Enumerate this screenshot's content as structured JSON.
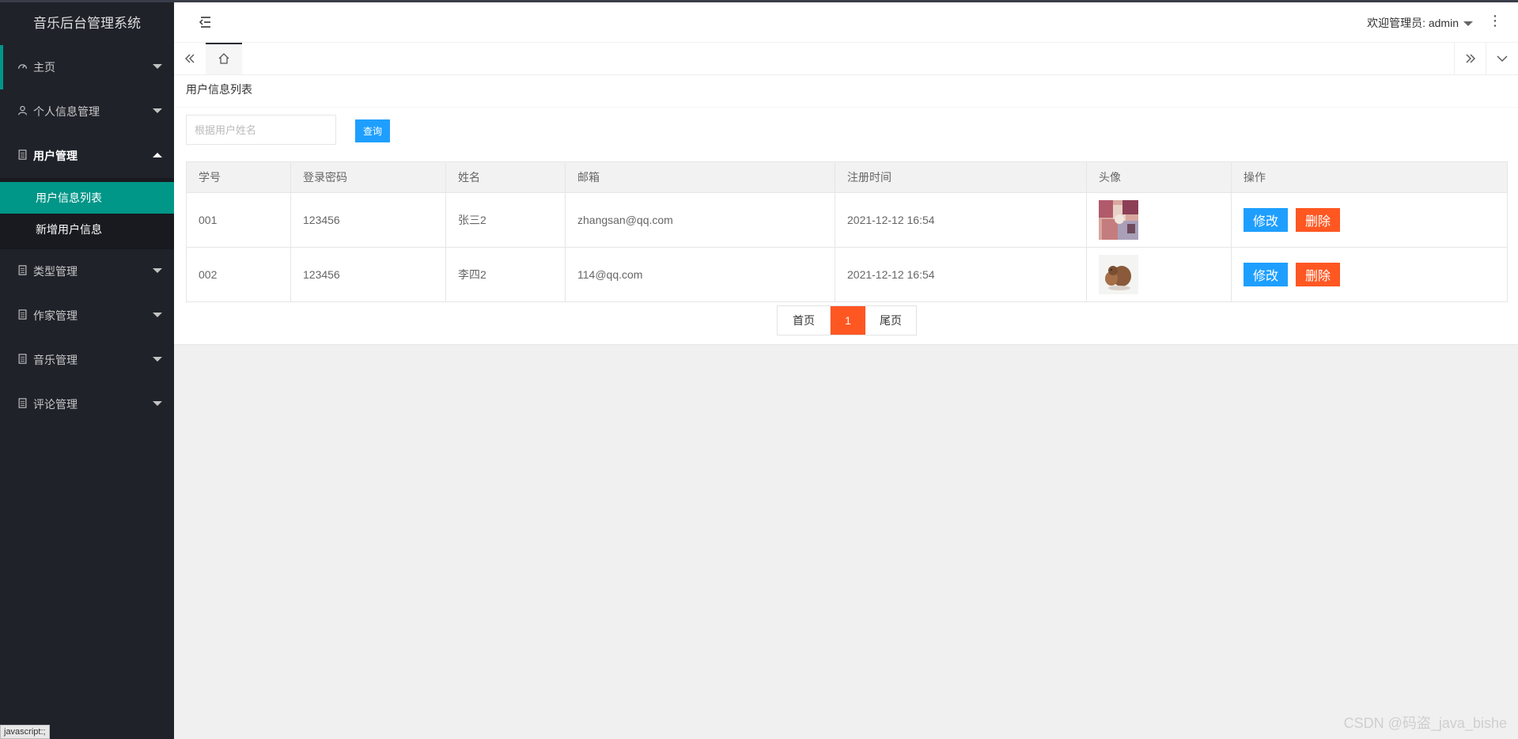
{
  "app_title": "音乐后台管理系统",
  "sidebar": {
    "items": [
      {
        "label": "主页"
      },
      {
        "label": "个人信息管理"
      },
      {
        "label": "用户管理"
      },
      {
        "label": "类型管理"
      },
      {
        "label": "作家管理"
      },
      {
        "label": "音乐管理"
      },
      {
        "label": "评论管理"
      }
    ],
    "sub_items": [
      {
        "label": "用户信息列表"
      },
      {
        "label": "新增用户信息"
      }
    ]
  },
  "header": {
    "welcome": "欢迎管理员: admin"
  },
  "page": {
    "title": "用户信息列表",
    "search_placeholder": "根据用户姓名",
    "search_button": "查询"
  },
  "table": {
    "columns": [
      "学号",
      "登录密码",
      "姓名",
      "邮箱",
      "注册时间",
      "头像",
      "操作"
    ],
    "rows": [
      {
        "id": "001",
        "password": "123456",
        "name": "张三2",
        "email": "zhangsan@qq.com",
        "time": "2021-12-12 16:54",
        "avatar": "colorful-photo"
      },
      {
        "id": "002",
        "password": "123456",
        "name": "李四2",
        "email": "114@qq.com",
        "time": "2021-12-12 16:54",
        "avatar": "squirrel-photo"
      }
    ],
    "edit_label": "修改",
    "delete_label": "删除"
  },
  "pagination": {
    "first": "首页",
    "current": "1",
    "last": "尾页"
  },
  "statusbar": "javascript:;",
  "watermark": "CSDN @码盗_java_bishe",
  "colors": {
    "accent": "#009688",
    "primary": "#1e9fff",
    "danger": "#ff5722",
    "sidebar_bg": "#20222a"
  }
}
